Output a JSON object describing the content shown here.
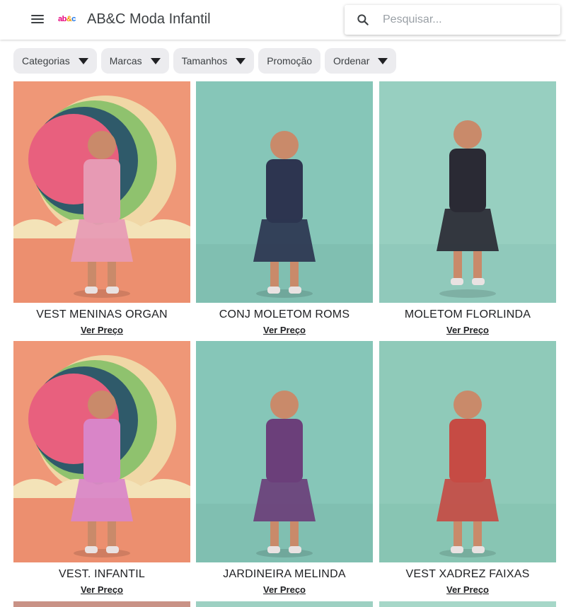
{
  "header": {
    "title": "AB&C Moda Infantil",
    "logo_text_1": "ab",
    "logo_text_2": "&",
    "logo_text_3": "c",
    "search_placeholder": "Pesquisar..."
  },
  "filters": [
    {
      "label": "Categorias",
      "has_dropdown": true
    },
    {
      "label": "Marcas",
      "has_dropdown": true
    },
    {
      "label": "Tamanhos",
      "has_dropdown": true
    },
    {
      "label": "Promoção",
      "has_dropdown": false
    },
    {
      "label": "Ordenar",
      "has_dropdown": true
    }
  ],
  "products": [
    {
      "name": "VEST MENINAS ORGAN",
      "price_link": "Ver Preço",
      "bg": "#ef9777",
      "accent": "#e8739a",
      "outfit": "#e79ab4"
    },
    {
      "name": "CONJ MOLETOM ROMS",
      "price_link": "Ver Preço",
      "bg": "#86c6b8",
      "accent": "#7ab8aa",
      "outfit": "#2d3550"
    },
    {
      "name": "MOLETOM FLORLINDA",
      "price_link": "Ver Preço",
      "bg": "#97cfc0",
      "accent": "#89c4b5",
      "outfit": "#2a2a34"
    },
    {
      "name": "VEST. INFANTIL",
      "price_link": "Ver Preço",
      "bg": "#ef9777",
      "accent": "#e8739a",
      "outfit": "#d985c8"
    },
    {
      "name": "JARDINEIRA MELINDA",
      "price_link": "Ver Preço",
      "bg": "#86c6b8",
      "accent": "#7ab8aa",
      "outfit": "#6b3f7a"
    },
    {
      "name": "VEST XADREZ FAIXAS",
      "price_link": "Ver Preço",
      "bg": "#8fcab9",
      "accent": "#82bfae",
      "outfit": "#c64b44"
    }
  ]
}
